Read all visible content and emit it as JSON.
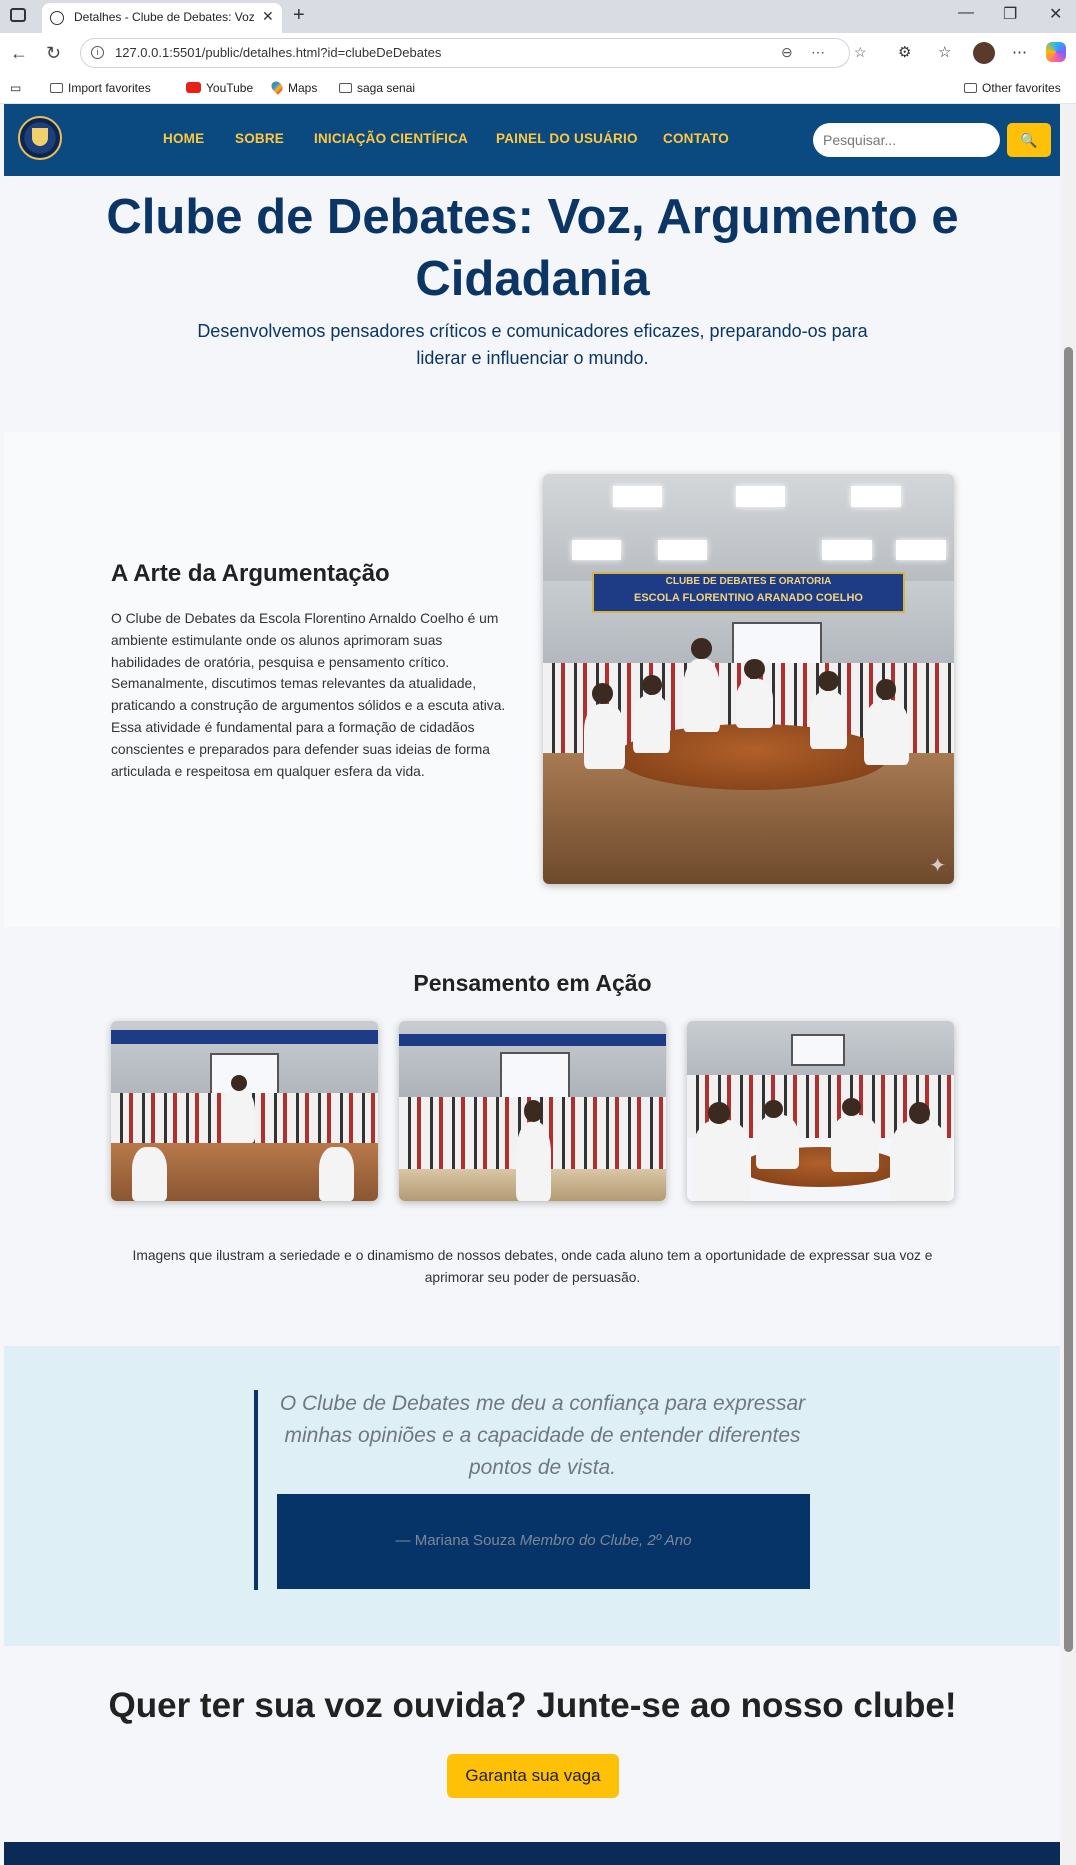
{
  "browser": {
    "tab_title": "Detalhes - Clube de Debates: Voz, A",
    "url": "127.0.0.1:5501/public/detalhes.html?id=clubeDeDebates",
    "bookmarks": [
      "Import favorites",
      "YouTube",
      "Maps",
      "saga senai"
    ],
    "other_favorites": "Other favorites"
  },
  "nav": {
    "links": [
      "HOME",
      "SOBRE",
      "INICIAÇÃO CIENTÍFICA",
      "PAINEL DO USUÁRIO",
      "CONTATO"
    ],
    "search_placeholder": "Pesquisar..."
  },
  "hero": {
    "title": "Clube de Debates: Voz, Argumento e Cidadania",
    "subtitle": "Desenvolvemos pensadores críticos e comunicadores eficazes, preparando-os para liderar e influenciar o mundo."
  },
  "art": {
    "title": "A Arte da Argumentação",
    "text": "O Clube de Debates da Escola Florentino Arnaldo Coelho é um ambiente estimulante onde os alunos aprimoram suas habilidades de oratória, pesquisa e pensamento crítico. Semanalmente, discutimos temas relevantes da atualidade, praticando a construção de argumentos sólidos e a escuta ativa. Essa atividade é fundamental para a formação de cidadãos conscientes e preparados para defender suas ideias de forma articulada e respeitosa em qualquer esfera da vida.",
    "banner_line1": "CLUBE DE DEBATES E ORATÓRIA",
    "banner_line2": "ESCOLA FLORENTINO ARANADO COELHO"
  },
  "gallery": {
    "title": "Pensamento em Ação",
    "caption": "Imagens que ilustram a seriedade e o dinamismo de nossos debates, onde cada aluno tem a oportunidade de expressar sua voz e aprimorar seu poder de persuasão."
  },
  "testimonial": {
    "quote": "O Clube de Debates me deu a confiança para expressar minhas opiniões e a capacidade de entender diferentes pontos de vista.",
    "author": "— Mariana Souza",
    "role": "Membro do Clube, 2º Ano"
  },
  "cta": {
    "title": "Quer ter sua voz ouvida? Junte-se ao nosso clube!",
    "button": "Garanta sua vaga"
  }
}
